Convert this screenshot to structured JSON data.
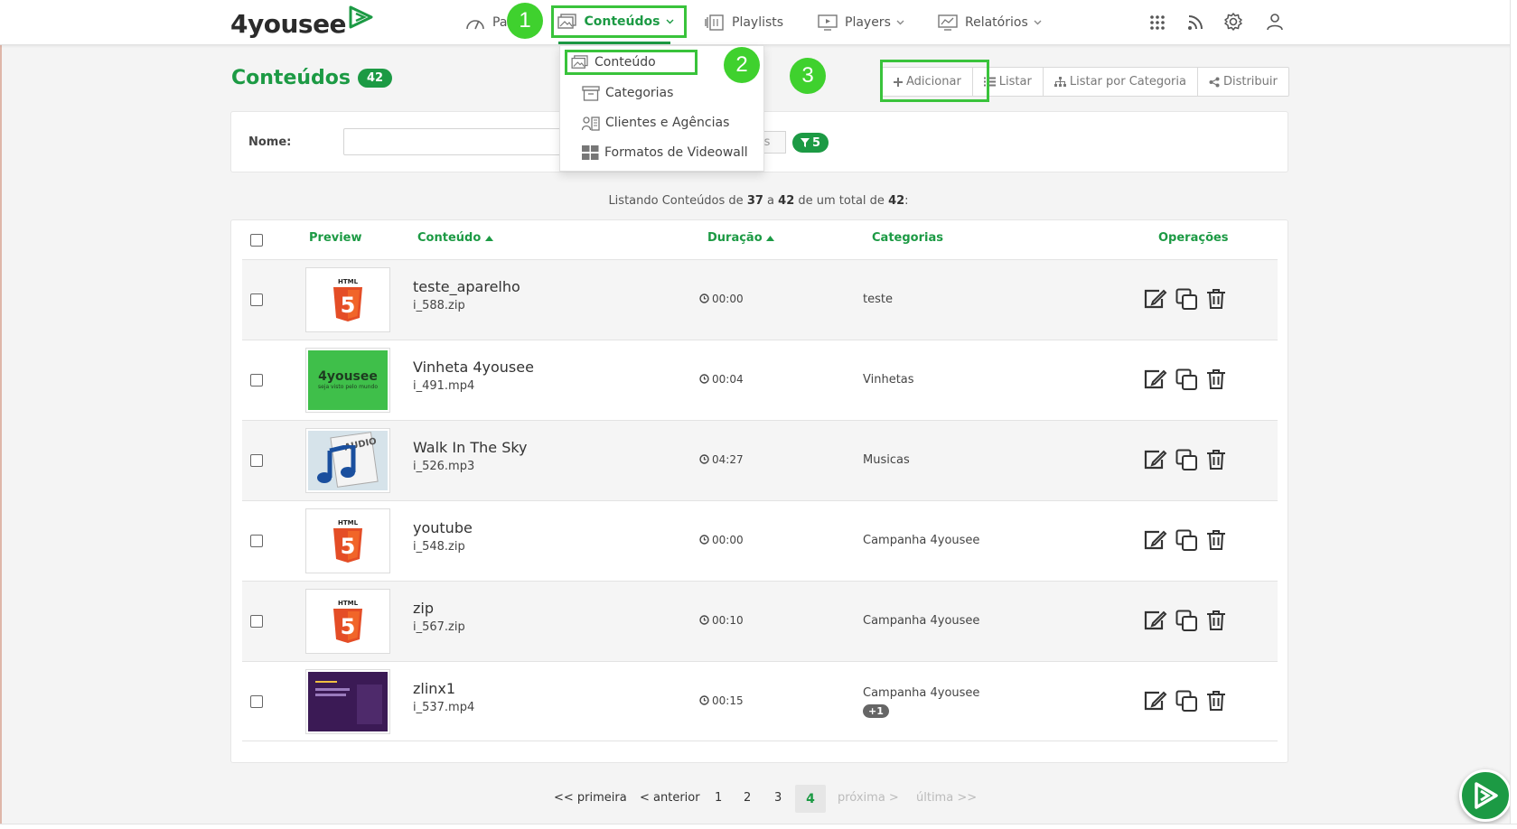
{
  "app": {
    "logo_text": "4yousee",
    "accent_color": "#1c9a44",
    "highlight_color": "#39c33b"
  },
  "nav": {
    "painel_label": "Pa",
    "conteudos_label": "Conteúdos",
    "playlists_label": "Playlists",
    "players_label": "Players",
    "relatorios_label": "Relatórios",
    "icons": [
      "apps-grid-icon",
      "rss-icon",
      "gear-icon",
      "user-icon"
    ]
  },
  "steps": [
    "1",
    "2",
    "3"
  ],
  "dropdown": {
    "items": [
      {
        "label": "Conteúdo",
        "icon": "image-icon"
      },
      {
        "label": "Categorias",
        "icon": "archive-icon"
      },
      {
        "label": "Clientes e Agências",
        "icon": "clients-icon"
      },
      {
        "label": "Formatos de Videowall",
        "icon": "grid-icon"
      }
    ]
  },
  "page": {
    "title": "Conteúdos",
    "count": "42"
  },
  "actions": {
    "add": "Adicionar",
    "list": "Listar",
    "list_by_category": "Listar por Categoria",
    "distribute": "Distribuir"
  },
  "filter": {
    "name_label": "Nome:",
    "name_value": "",
    "partial_button": "os",
    "filter_count": "5"
  },
  "listing": {
    "prefix": "Listando Conteúdos de",
    "from": "37",
    "a": "a",
    "to": "42",
    "mid": "de um total de",
    "total": "42",
    "suffix": ":"
  },
  "table": {
    "headers": {
      "preview": "Preview",
      "content": "Conteúdo",
      "duration": "Duração",
      "categories": "Categorias",
      "operations": "Operações"
    },
    "rows": [
      {
        "name": "teste_aparelho",
        "file": "i_588.zip",
        "duration": "00:00",
        "category": "teste",
        "extra": "",
        "preview": "html5"
      },
      {
        "name": "Vinheta 4yousee",
        "file": "i_491.mp4",
        "duration": "00:04",
        "category": "Vinhetas",
        "extra": "",
        "preview": "vinheta"
      },
      {
        "name": "Walk In The Sky",
        "file": "i_526.mp3",
        "duration": "04:27",
        "category": "Musicas",
        "extra": "",
        "preview": "audio"
      },
      {
        "name": "youtube",
        "file": "i_548.zip",
        "duration": "00:00",
        "category": "Campanha 4yousee",
        "extra": "",
        "preview": "html5"
      },
      {
        "name": "zip",
        "file": "i_567.zip",
        "duration": "00:10",
        "category": "Campanha 4yousee",
        "extra": "",
        "preview": "html5"
      },
      {
        "name": "zlinx1",
        "file": "i_537.mp4",
        "duration": "00:15",
        "category": "Campanha 4yousee",
        "extra": "+1",
        "preview": "video"
      }
    ],
    "thumb_texts": {
      "html": "HTML",
      "html_num": "5",
      "vinheta_logo": "4yousee",
      "vinheta_sub": "seja visto pelo mundo",
      "audio": "AUDIO"
    }
  },
  "pagination": {
    "first": "<< primeira",
    "prev": "< anterior",
    "pages": [
      "1",
      "2",
      "3",
      "4"
    ],
    "current": "4",
    "next": "próxima >",
    "last": "última >>"
  }
}
